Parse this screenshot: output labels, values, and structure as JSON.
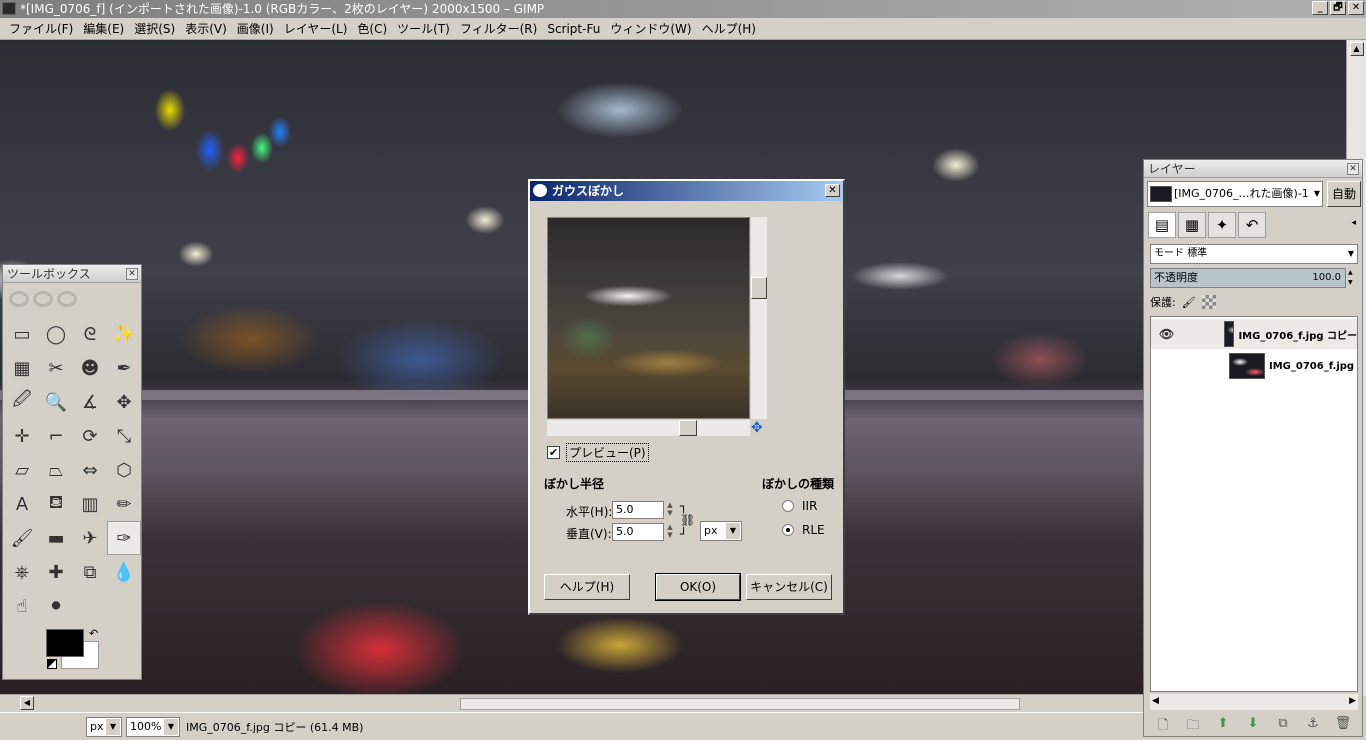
{
  "window": {
    "title": "*[IMG_0706_f] (インポートされた画像)-1.0 (RGBカラー、2枚のレイヤー) 2000x1500 – GIMP",
    "minimize": "_",
    "maximize": "🗗",
    "close": "✕"
  },
  "menu": [
    "ファイル(F)",
    "編集(E)",
    "選択(S)",
    "表示(V)",
    "画像(I)",
    "レイヤー(L)",
    "色(C)",
    "ツール(T)",
    "フィルター(R)",
    "Script-Fu",
    "ウィンドウ(W)",
    "ヘルプ(H)"
  ],
  "status": {
    "unit": "px",
    "zoom": "100%",
    "info": "IMG_0706_f.jpg コピー (61.4 MB)"
  },
  "toolbox": {
    "title": "ツールボックス",
    "close": "✕",
    "tools": [
      {
        "name": "rect-select-icon",
        "glyph": "▭"
      },
      {
        "name": "ellipse-select-icon",
        "glyph": "◯"
      },
      {
        "name": "free-select-icon",
        "glyph": "ᘓ"
      },
      {
        "name": "fuzzy-select-icon",
        "glyph": "✨"
      },
      {
        "name": "color-select-icon",
        "glyph": "▦"
      },
      {
        "name": "scissors-icon",
        "glyph": "✂"
      },
      {
        "name": "foreground-select-icon",
        "glyph": "☻"
      },
      {
        "name": "paths-icon",
        "glyph": "✒"
      },
      {
        "name": "color-picker-icon",
        "glyph": "🖉"
      },
      {
        "name": "zoom-icon",
        "glyph": "🔍"
      },
      {
        "name": "measure-icon",
        "glyph": "∡"
      },
      {
        "name": "move-icon",
        "glyph": "✥"
      },
      {
        "name": "align-icon",
        "glyph": "✛"
      },
      {
        "name": "crop-icon",
        "glyph": "⌐"
      },
      {
        "name": "rotate-icon",
        "glyph": "⟳"
      },
      {
        "name": "scale-icon",
        "glyph": "⤡"
      },
      {
        "name": "shear-icon",
        "glyph": "▱"
      },
      {
        "name": "perspective-icon",
        "glyph": "⏢"
      },
      {
        "name": "flip-icon",
        "glyph": "⇔"
      },
      {
        "name": "cage-icon",
        "glyph": "⬡"
      },
      {
        "name": "text-icon",
        "glyph": "A"
      },
      {
        "name": "bucket-fill-icon",
        "glyph": "⛾"
      },
      {
        "name": "blend-icon",
        "glyph": "▥"
      },
      {
        "name": "pencil-icon",
        "glyph": "✏"
      },
      {
        "name": "paintbrush-icon",
        "glyph": "🖌"
      },
      {
        "name": "eraser-icon",
        "glyph": "▬"
      },
      {
        "name": "airbrush-icon",
        "glyph": "✈"
      },
      {
        "name": "ink-icon",
        "glyph": "✑"
      },
      {
        "name": "clone-icon",
        "glyph": "⎈"
      },
      {
        "name": "heal-icon",
        "glyph": "✚"
      },
      {
        "name": "perspective-clone-icon",
        "glyph": "⧉"
      },
      {
        "name": "blur-icon",
        "glyph": "💧"
      },
      {
        "name": "smudge-icon",
        "glyph": "☝"
      },
      {
        "name": "dodge-burn-icon",
        "glyph": "⚫"
      }
    ],
    "active_tool": 27,
    "swap_glyph": "↶"
  },
  "dialog": {
    "title": "ガウスぼかし",
    "close": "✕",
    "preview_label": "プレビュー(P)",
    "preview_checked": true,
    "radius_title": "ぼかし半径",
    "horizontal_label": "水平(H):",
    "horizontal_value": "5.0",
    "vertical_label": "垂直(V):",
    "vertical_value": "5.0",
    "unit": "px",
    "method_title": "ぼかしの種類",
    "method_options": [
      "IIR",
      "RLE"
    ],
    "method_selected": "RLE",
    "help_button": "ヘルプ(H)",
    "ok_button": "OK(O)",
    "cancel_button": "キャンセル(C)"
  },
  "layers": {
    "title": "レイヤー",
    "close": "✕",
    "image_select": "[IMG_0706_…れた画像)-1",
    "auto_button": "自動",
    "mode_label": "モード",
    "mode_value": "標準",
    "opacity_label": "不透明度",
    "opacity_value": "100.0",
    "lock_label": "保護:",
    "items": [
      {
        "name": "IMG_0706_f.jpg コピー",
        "visible": true,
        "selected": true
      },
      {
        "name": "IMG_0706_f.jpg",
        "visible": false,
        "selected": false
      }
    ]
  }
}
